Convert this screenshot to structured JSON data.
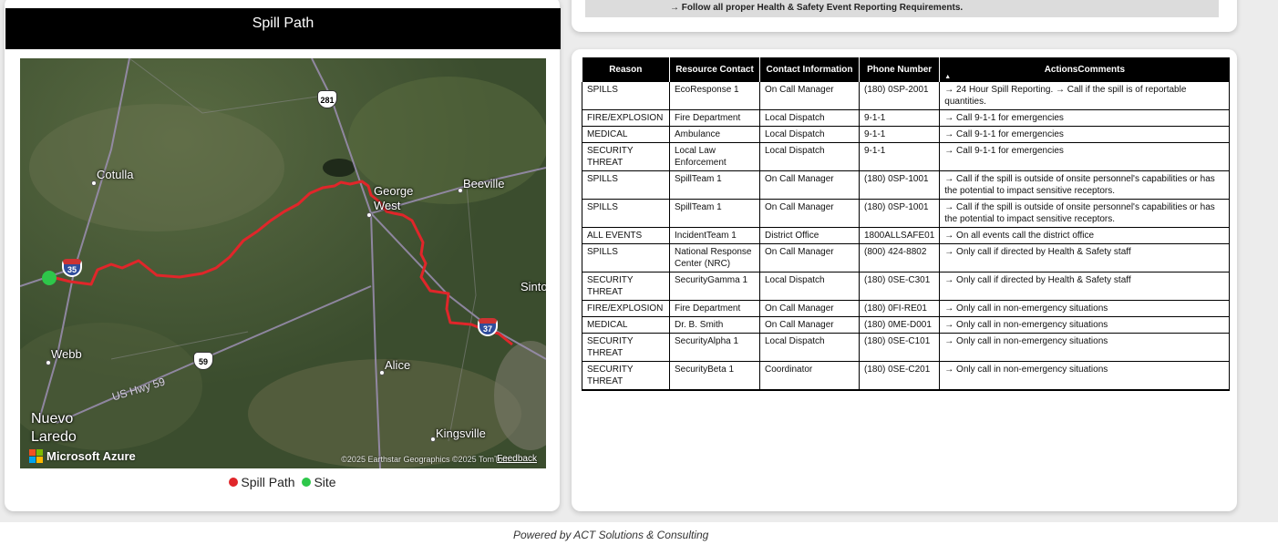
{
  "map_card": {
    "title": "Spill Path",
    "map": {
      "cities": {
        "cotulla": "Cotulla",
        "george_west": "George\nWest",
        "beeville": "Beeville",
        "webb": "Webb",
        "alice": "Alice",
        "nuevo_laredo": "Nuevo\nLaredo",
        "kingsville": "Kingsville",
        "sinton": "Sinto"
      },
      "highway_label": "US Hwy 59",
      "shields": {
        "i35": "35",
        "us281": "281",
        "us59": "59"
      },
      "brand": "Microsoft Azure",
      "attribution": "©2025 Earthstar Geographics ©2025 TomTom",
      "feedback": "Feedback"
    },
    "legend": [
      {
        "label": "Spill Path",
        "color": "#e0262a"
      },
      {
        "label": "Site",
        "color": "#2ec74a"
      }
    ]
  },
  "requirement_note": "→ Follow all proper Health & Safety Event Reporting Requirements.",
  "table": {
    "headers": [
      "Reason",
      "Resource Contact",
      "Contact Information",
      "Phone Number",
      "ActionsComments"
    ],
    "sort_indicator": "▲",
    "rows": [
      [
        "SPILLS",
        "EcoResponse 1",
        "On Call Manager",
        "(180) 0SP-2001",
        "→ 24 Hour Spill Reporting. → Call if the spill is of reportable quantities."
      ],
      [
        "FIRE/EXPLOSION",
        "Fire Department",
        "Local Dispatch",
        "9-1-1",
        "→ Call 9-1-1 for emergencies"
      ],
      [
        "MEDICAL",
        "Ambulance",
        "Local Dispatch",
        "9-1-1",
        "→ Call 9-1-1 for emergencies"
      ],
      [
        "SECURITY THREAT",
        "Local Law Enforcement",
        "Local Dispatch",
        "9-1-1",
        "→ Call 9-1-1 for emergencies"
      ],
      [
        "SPILLS",
        "SpillTeam 1",
        "On Call Manager",
        "(180) 0SP-1001",
        "→ Call if the spill is outside of onsite personnel's capabilities or has the potential to impact sensitive receptors."
      ],
      [
        "SPILLS",
        "SpillTeam 1",
        "On Call Manager",
        "(180) 0SP-1001",
        "→ Call if the spill is outside of onsite personnel's capabilities or has the potential to impact sensitive receptors."
      ],
      [
        "ALL EVENTS",
        "IncidentTeam 1",
        "District Office",
        "1800ALLSAFE01",
        "→ On all events call the district office"
      ],
      [
        "SPILLS",
        "National Response Center (NRC)",
        "On Call Manager",
        "(800) 424-8802",
        "→ Only call if directed by Health & Safety staff"
      ],
      [
        "SECURITY THREAT",
        "SecurityGamma 1",
        "Local Dispatch",
        "(180) 0SE-C301",
        "→ Only call if directed by Health & Safety staff"
      ],
      [
        "FIRE/EXPLOSION",
        "Fire Department",
        "On Call Manager",
        "(180) 0FI-RE01",
        "→ Only call in non-emergency situations"
      ],
      [
        "MEDICAL",
        "Dr. B. Smith",
        "On Call Manager",
        "(180) 0ME-D001",
        "→ Only call in non-emergency situations"
      ],
      [
        "SECURITY THREAT",
        "SecurityAlpha 1",
        "Local Dispatch",
        "(180) 0SE-C101",
        "→ Only call in non-emergency situations"
      ],
      [
        "SECURITY THREAT",
        "SecurityBeta 1",
        "Coordinator",
        "(180) 0SE-C201",
        "→ Only call in non-emergency situations"
      ]
    ]
  },
  "footer": "Powered by ACT Solutions & Consulting"
}
